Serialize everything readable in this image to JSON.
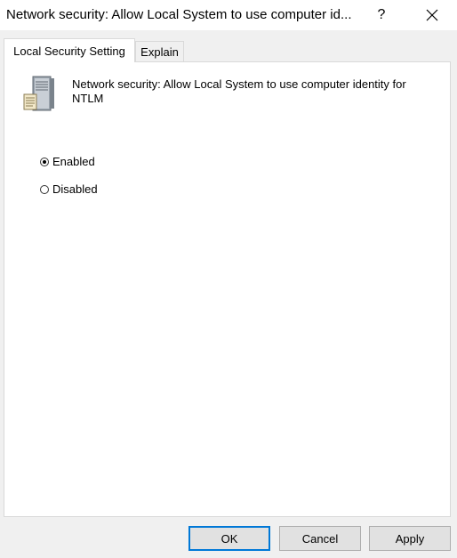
{
  "window": {
    "title": "Network security: Allow Local System to use computer id...",
    "help_label": "?"
  },
  "tabs": [
    {
      "label": "Local Security Setting",
      "active": true
    },
    {
      "label": "Explain",
      "active": false
    }
  ],
  "policy": {
    "icon": "server-icon",
    "title": "Network security: Allow Local System to use computer identity for NTLM"
  },
  "options": [
    {
      "label": "Enabled",
      "selected": true
    },
    {
      "label": "Disabled",
      "selected": false
    }
  ],
  "buttons": {
    "ok": "OK",
    "cancel": "Cancel",
    "apply": "Apply"
  },
  "colors": {
    "accent": "#0078d7",
    "panel": "#ffffff",
    "background": "#f0f0f0"
  }
}
